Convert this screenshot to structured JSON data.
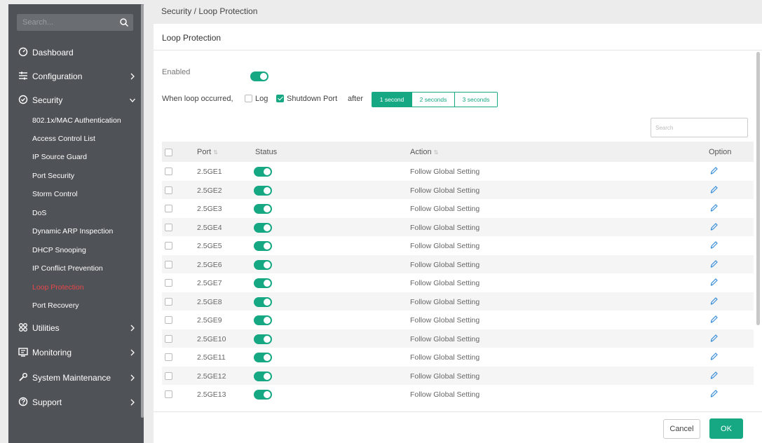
{
  "sidebar": {
    "search_placeholder": "Search...",
    "nav": [
      {
        "label": "Dashboard",
        "icon": "dashboard-icon"
      },
      {
        "label": "Configuration",
        "icon": "sliders-icon"
      },
      {
        "label": "Security",
        "icon": "shield-icon"
      },
      {
        "label": "Utilities",
        "icon": "grid-icon"
      },
      {
        "label": "Monitoring",
        "icon": "monitor-icon"
      },
      {
        "label": "System Maintenance",
        "icon": "wrench-icon"
      },
      {
        "label": "Support",
        "icon": "help-icon"
      }
    ],
    "security_sub": [
      "802.1x/MAC Authentication",
      "Access Control List",
      "IP Source Guard",
      "Port Security",
      "Storm Control",
      "DoS",
      "Dynamic ARP Inspection",
      "DHCP Snooping",
      "IP Conflict Prevention",
      "Loop Protection",
      "Port Recovery"
    ],
    "active_sub": "Loop Protection"
  },
  "breadcrumb": "Security / Loop Protection",
  "panel": {
    "title": "Loop Protection",
    "enabled_label": "Enabled",
    "enabled": true,
    "loop_label": "When loop occurred,",
    "log_label": "Log",
    "log_checked": false,
    "shutdown_label": "Shutdown Port",
    "shutdown_checked": true,
    "after_label": "after",
    "intervals": [
      "1 second",
      "2 seconds",
      "3 seconds"
    ],
    "selected_interval": "1 second",
    "search_placeholder": "Search"
  },
  "table": {
    "headers": {
      "port": "Port",
      "status": "Status",
      "action": "Action",
      "option": "Option"
    },
    "rows": [
      {
        "port": "2.5GE1",
        "status": true,
        "action": "Follow Global Setting"
      },
      {
        "port": "2.5GE2",
        "status": true,
        "action": "Follow Global Setting"
      },
      {
        "port": "2.5GE3",
        "status": true,
        "action": "Follow Global Setting"
      },
      {
        "port": "2.5GE4",
        "status": true,
        "action": "Follow Global Setting"
      },
      {
        "port": "2.5GE5",
        "status": true,
        "action": "Follow Global Setting"
      },
      {
        "port": "2.5GE6",
        "status": true,
        "action": "Follow Global Setting"
      },
      {
        "port": "2.5GE7",
        "status": true,
        "action": "Follow Global Setting"
      },
      {
        "port": "2.5GE8",
        "status": true,
        "action": "Follow Global Setting"
      },
      {
        "port": "2.5GE9",
        "status": true,
        "action": "Follow Global Setting"
      },
      {
        "port": "2.5GE10",
        "status": true,
        "action": "Follow Global Setting"
      },
      {
        "port": "2.5GE11",
        "status": true,
        "action": "Follow Global Setting"
      },
      {
        "port": "2.5GE12",
        "status": true,
        "action": "Follow Global Setting"
      },
      {
        "port": "2.5GE13",
        "status": true,
        "action": "Follow Global Setting"
      }
    ]
  },
  "footer": {
    "cancel": "Cancel",
    "ok": "OK"
  },
  "colors": {
    "accent": "#16a883",
    "sidebar_bg": "#4f5256",
    "active_sub": "#e8474b"
  }
}
